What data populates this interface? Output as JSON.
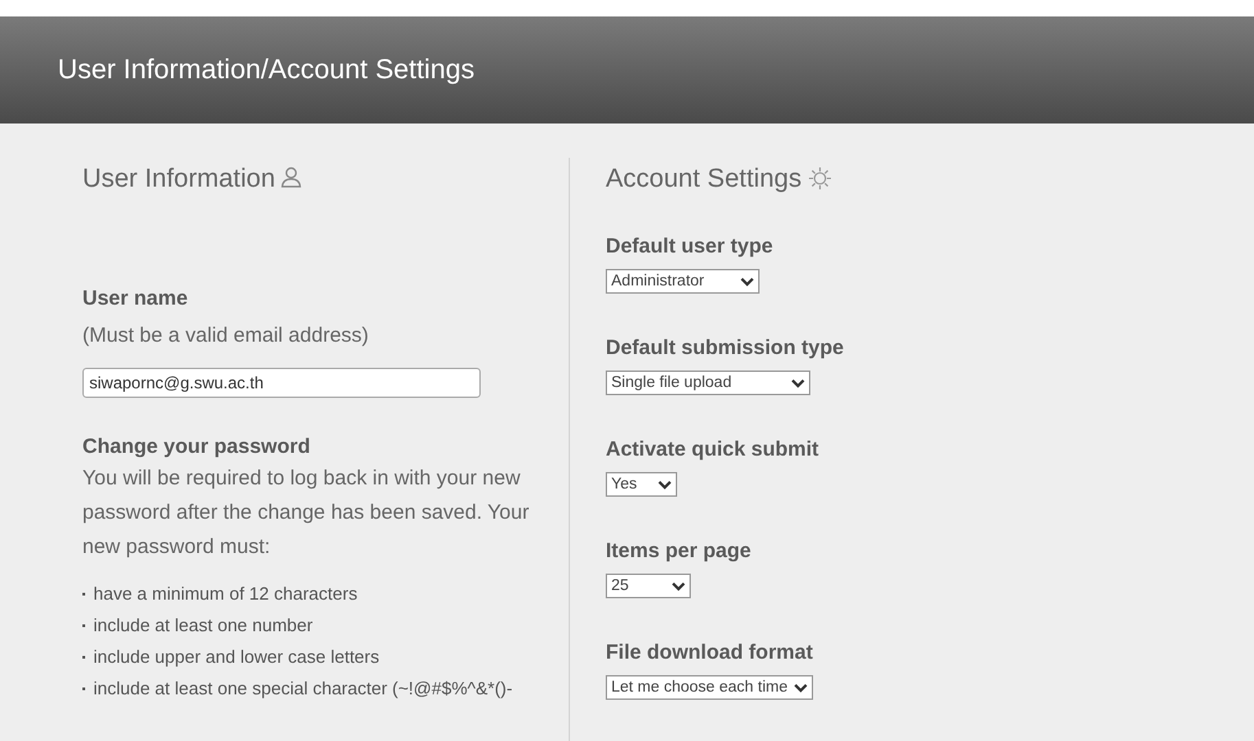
{
  "header": {
    "title": "User Information/Account Settings"
  },
  "user_information": {
    "title": "User Information",
    "username_label": "User name",
    "username_hint": "(Must be a valid email address)",
    "username_value": "siwapornc@g.swu.ac.th",
    "password_title": "Change your password",
    "password_text": "You will be required to log back in with your new password after the change has been saved. Your new password must:",
    "rules": [
      "have a minimum of 12 characters",
      "include at least one number",
      "include upper and lower case letters",
      "include at least one special character (~!@#$%^&*()-"
    ]
  },
  "account_settings": {
    "title": "Account Settings",
    "settings": [
      {
        "label": "Default user type",
        "value": "Administrator"
      },
      {
        "label": "Default submission type",
        "value": "Single file upload"
      },
      {
        "label": "Activate quick submit",
        "value": "Yes"
      },
      {
        "label": "Items per page",
        "value": "25"
      },
      {
        "label": "File download format",
        "value": "Let me choose each time"
      }
    ]
  }
}
